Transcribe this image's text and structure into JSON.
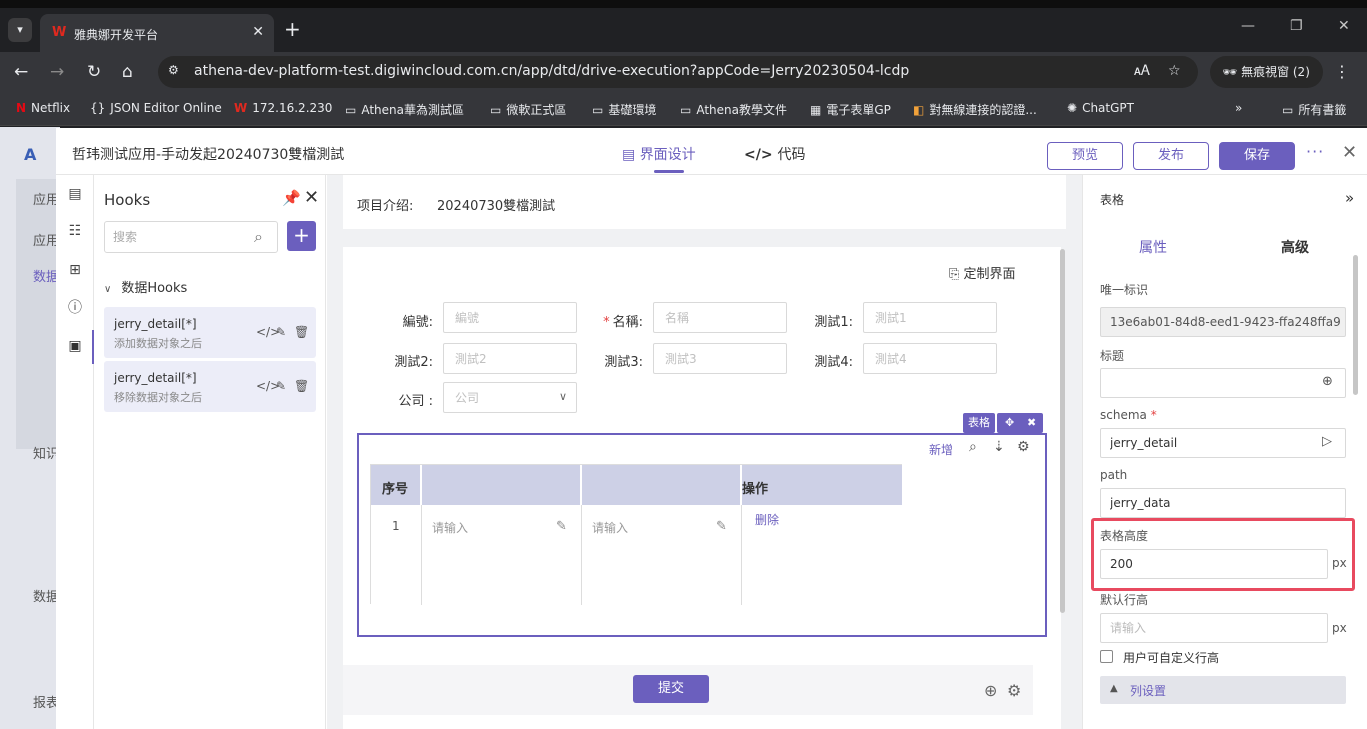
{
  "browser": {
    "tab_title": "雅典娜开发平台",
    "url": "athena-dev-platform-test.digiwincloud.com.cn/app/dtd/drive-execution?appCode=Jerry20230504-lcdp",
    "incognito_label": "無痕視窗 (2)",
    "bookmarks": [
      "Netflix",
      "JSON Editor Online",
      "172.16.2.230",
      "Athena華為測試區",
      "微軟正式區",
      "基礎環境",
      "Athena教學文件",
      "電子表單GP",
      "對無線連接的認證...",
      "ChatGPT",
      "所有書籤"
    ]
  },
  "bgapp": {
    "items": [
      "应用",
      "应用",
      "数据",
      "知识",
      "数据",
      "报表"
    ]
  },
  "header": {
    "title": "哲玮测试应用-手动发起20240730雙檔測試",
    "tab_design": "界面设计",
    "tab_code": "代码",
    "preview": "预览",
    "publish": "发布",
    "save": "保存"
  },
  "hooks": {
    "title": "Hooks",
    "search_placeholder": "搜索",
    "group_label": "数据Hooks",
    "items": [
      {
        "name": "jerry_detail[*]",
        "desc": "添加数据对象之后"
      },
      {
        "name": "jerry_detail[*]",
        "desc": "移除数据对象之后"
      }
    ]
  },
  "canvas": {
    "project_label": "项目介绍:",
    "project_value": "20240730雙檔測試",
    "custom_link": "定制界面",
    "fields": [
      {
        "label": "編號:",
        "placeholder": "編號",
        "required": false
      },
      {
        "label": "名稱:",
        "placeholder": "名稱",
        "required": true
      },
      {
        "label": "測試1:",
        "placeholder": "測試1",
        "required": false
      },
      {
        "label": "測試2:",
        "placeholder": "測試2",
        "required": false
      },
      {
        "label": "測試3:",
        "placeholder": "測試3",
        "required": false
      },
      {
        "label": "測試4:",
        "placeholder": "測試4",
        "required": false
      },
      {
        "label": "公司 :",
        "placeholder": "公司",
        "required": false
      }
    ],
    "required_mark": "*",
    "table_tag": "表格",
    "table_new": "新增",
    "table_headers": [
      "序号",
      "",
      "",
      "操作"
    ],
    "table_row": {
      "index": "1",
      "cell1": "请输入",
      "cell2": "请输入",
      "action": "删除"
    },
    "submit": "提交"
  },
  "props": {
    "title": "表格",
    "tab_attrs": "属性",
    "tab_advanced": "高级",
    "id_label": "唯一标识",
    "id_value": "13e6ab01-84d8-eed1-9423-ffa248ffa9",
    "title_label": "标题",
    "title_value": "",
    "schema_label": "schema",
    "schema_value": "jerry_detail",
    "path_label": "path",
    "path_value": "jerry_data",
    "height_label": "表格高度",
    "height_value": "200",
    "unit": "px",
    "rowheight_label": "默认行高",
    "rowheight_placeholder": "请输入",
    "custom_row_label": "用户可自定义行高",
    "colset_label": "列设置"
  },
  "colors": {
    "accent": "#6b5fbe",
    "highlight": "#e84a5f",
    "required": "#e34040"
  }
}
